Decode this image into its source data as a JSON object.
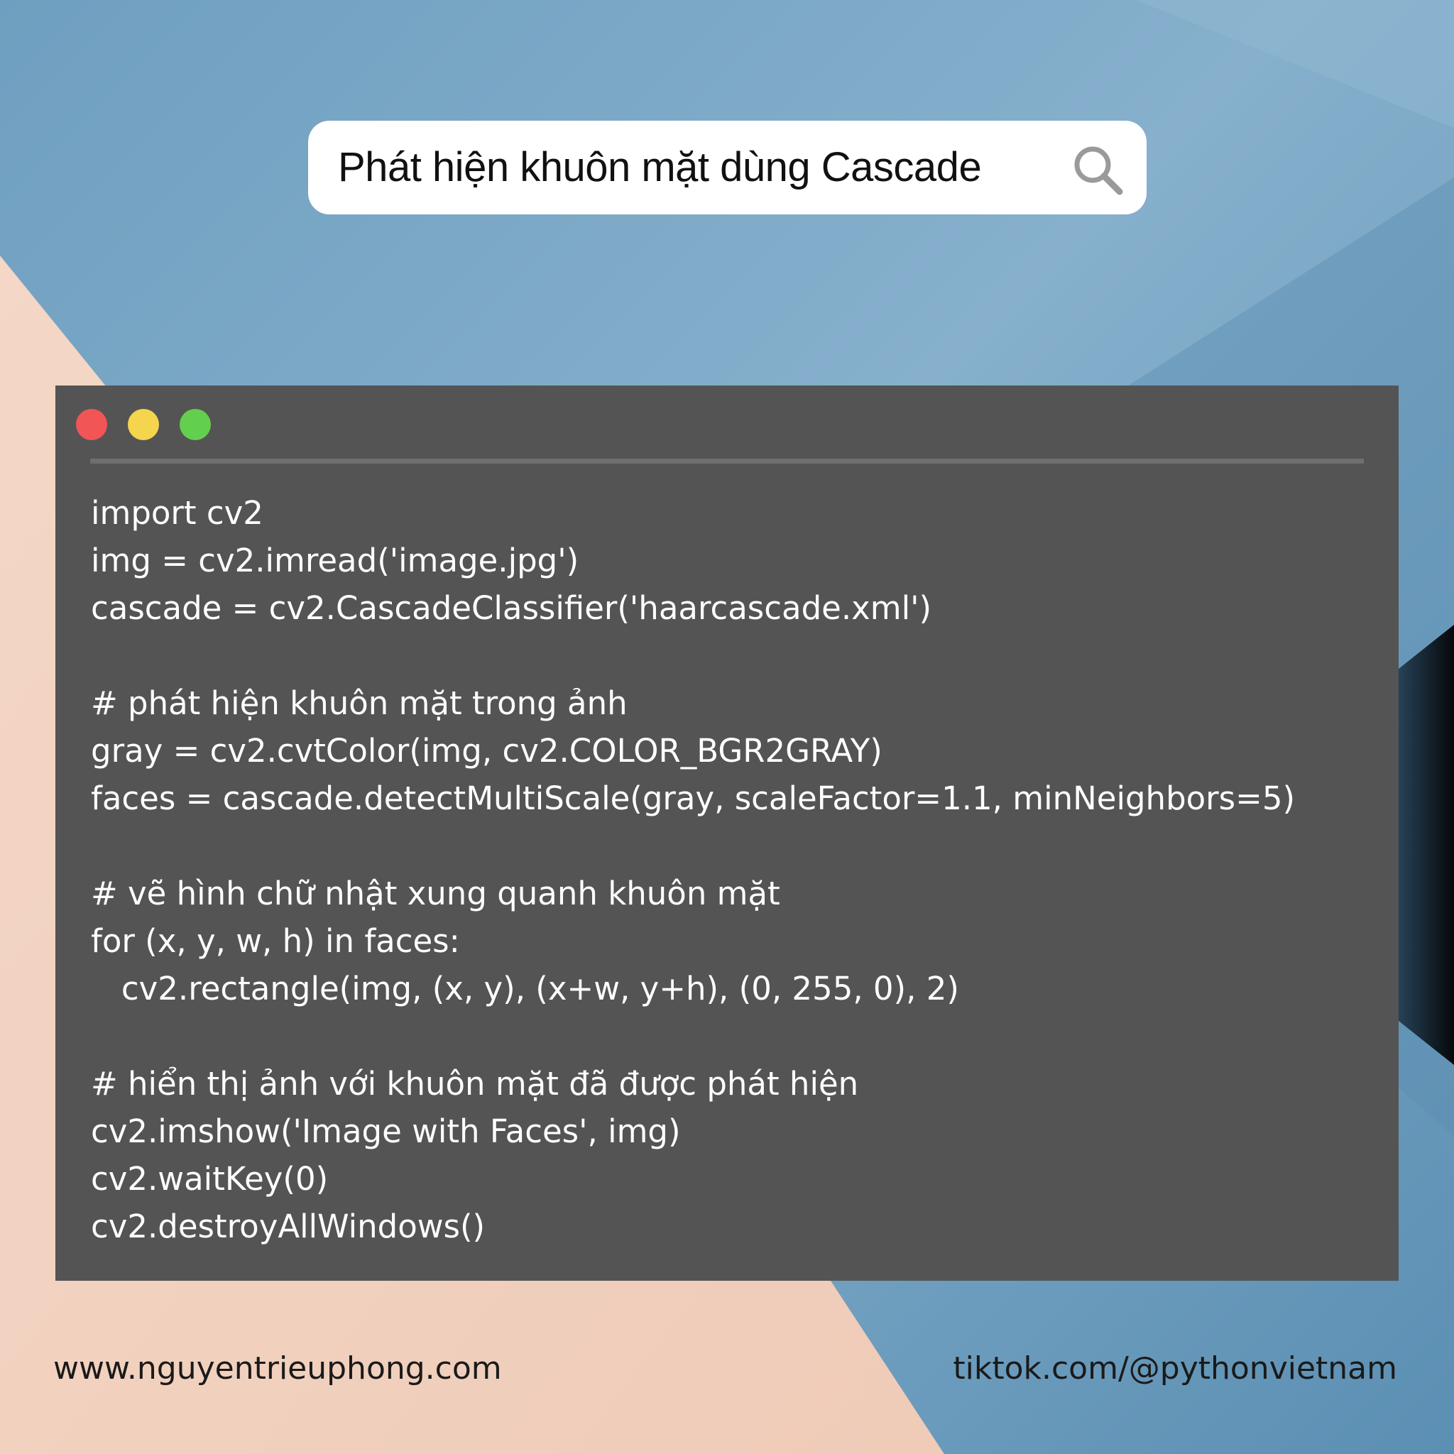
{
  "search": {
    "query": "Phát hiện khuôn mặt dùng Cascade",
    "icon": "search-icon"
  },
  "window": {
    "controls": [
      {
        "name": "close",
        "color": "#f25555"
      },
      {
        "name": "minimize",
        "color": "#f5d54e"
      },
      {
        "name": "maximize",
        "color": "#63cf4f"
      }
    ],
    "background_color": "#545454"
  },
  "code": {
    "lines": [
      "import cv2",
      "img = cv2.imread('image.jpg')",
      "cascade = cv2.CascadeClassifier('haarcascade.xml')",
      "",
      "# phát hiện khuôn mặt trong ảnh",
      "gray = cv2.cvtColor(img, cv2.COLOR_BGR2GRAY)",
      "faces = cascade.detectMultiScale(gray, scaleFactor=1.1, minNeighbors=5)",
      "",
      "# vẽ hình chữ nhật xung quanh khuôn mặt",
      "for (x, y, w, h) in faces:",
      "   cv2.rectangle(img, (x, y), (x+w, y+h), (0, 255, 0), 2)",
      "",
      "# hiển thị ảnh với khuôn mặt đã được phát hiện",
      "cv2.imshow('Image with Faces', img)",
      "cv2.waitKey(0)",
      "cv2.destroyAllWindows()"
    ]
  },
  "footer": {
    "website": "www.nguyentrieuphong.com",
    "tiktok": "tiktok.com/@pythonvietnam"
  },
  "colors": {
    "blue_background": "#7ea9c6",
    "peach_background": "#f2d2c1",
    "code_text": "#ffffff"
  }
}
